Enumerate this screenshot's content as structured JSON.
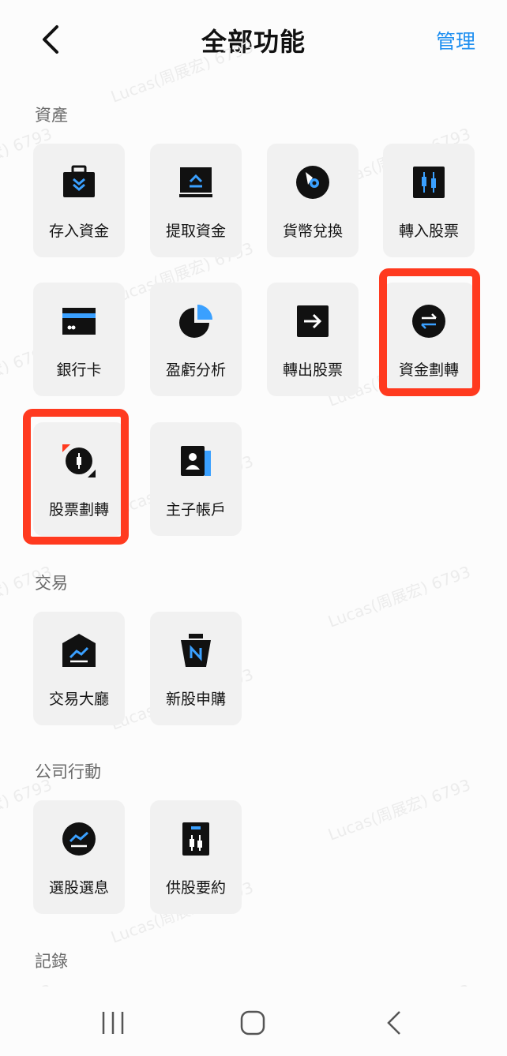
{
  "header": {
    "title": "全部功能",
    "manage_label": "管理"
  },
  "sections": {
    "assets": {
      "title": "資產",
      "items": [
        "存入資金",
        "提取資金",
        "貨幣兌換",
        "轉入股票",
        "銀行卡",
        "盈虧分析",
        "轉出股票",
        "資金劃轉",
        "股票劃轉",
        "主子帳戶"
      ]
    },
    "trade": {
      "title": "交易",
      "items": [
        "交易大廳",
        "新股申購"
      ]
    },
    "corporate": {
      "title": "公司行動",
      "items": [
        "選股選息",
        "供股要約"
      ]
    },
    "records": {
      "title": "記錄"
    }
  },
  "highlighted_items": [
    "資金劃轉",
    "股票劃轉"
  ],
  "watermark": "Lucas(周展宏) 6793",
  "icons": {
    "back": "chevron-left-icon",
    "deposit": "briefcase-down-icon",
    "withdraw": "monitor-up-icon",
    "exchange": "currency-exchange-icon",
    "transfer_in": "candlestick-icon",
    "bank_card": "card-icon",
    "pnl": "pie-chart-icon",
    "transfer_out": "arrow-right-icon",
    "fund_transfer": "swap-circle-icon",
    "stock_transfer": "stock-swap-icon",
    "sub_account": "contact-book-icon",
    "trading_hall": "hall-chart-icon",
    "ipo": "ipo-bag-icon",
    "election": "trend-circle-icon",
    "rights_offer": "candlestick-card-icon"
  },
  "colors": {
    "accent": "#1f8ff0",
    "highlight": "#ff3a1f",
    "icon_dark": "#111111",
    "icon_blue": "#3aa0ff"
  }
}
